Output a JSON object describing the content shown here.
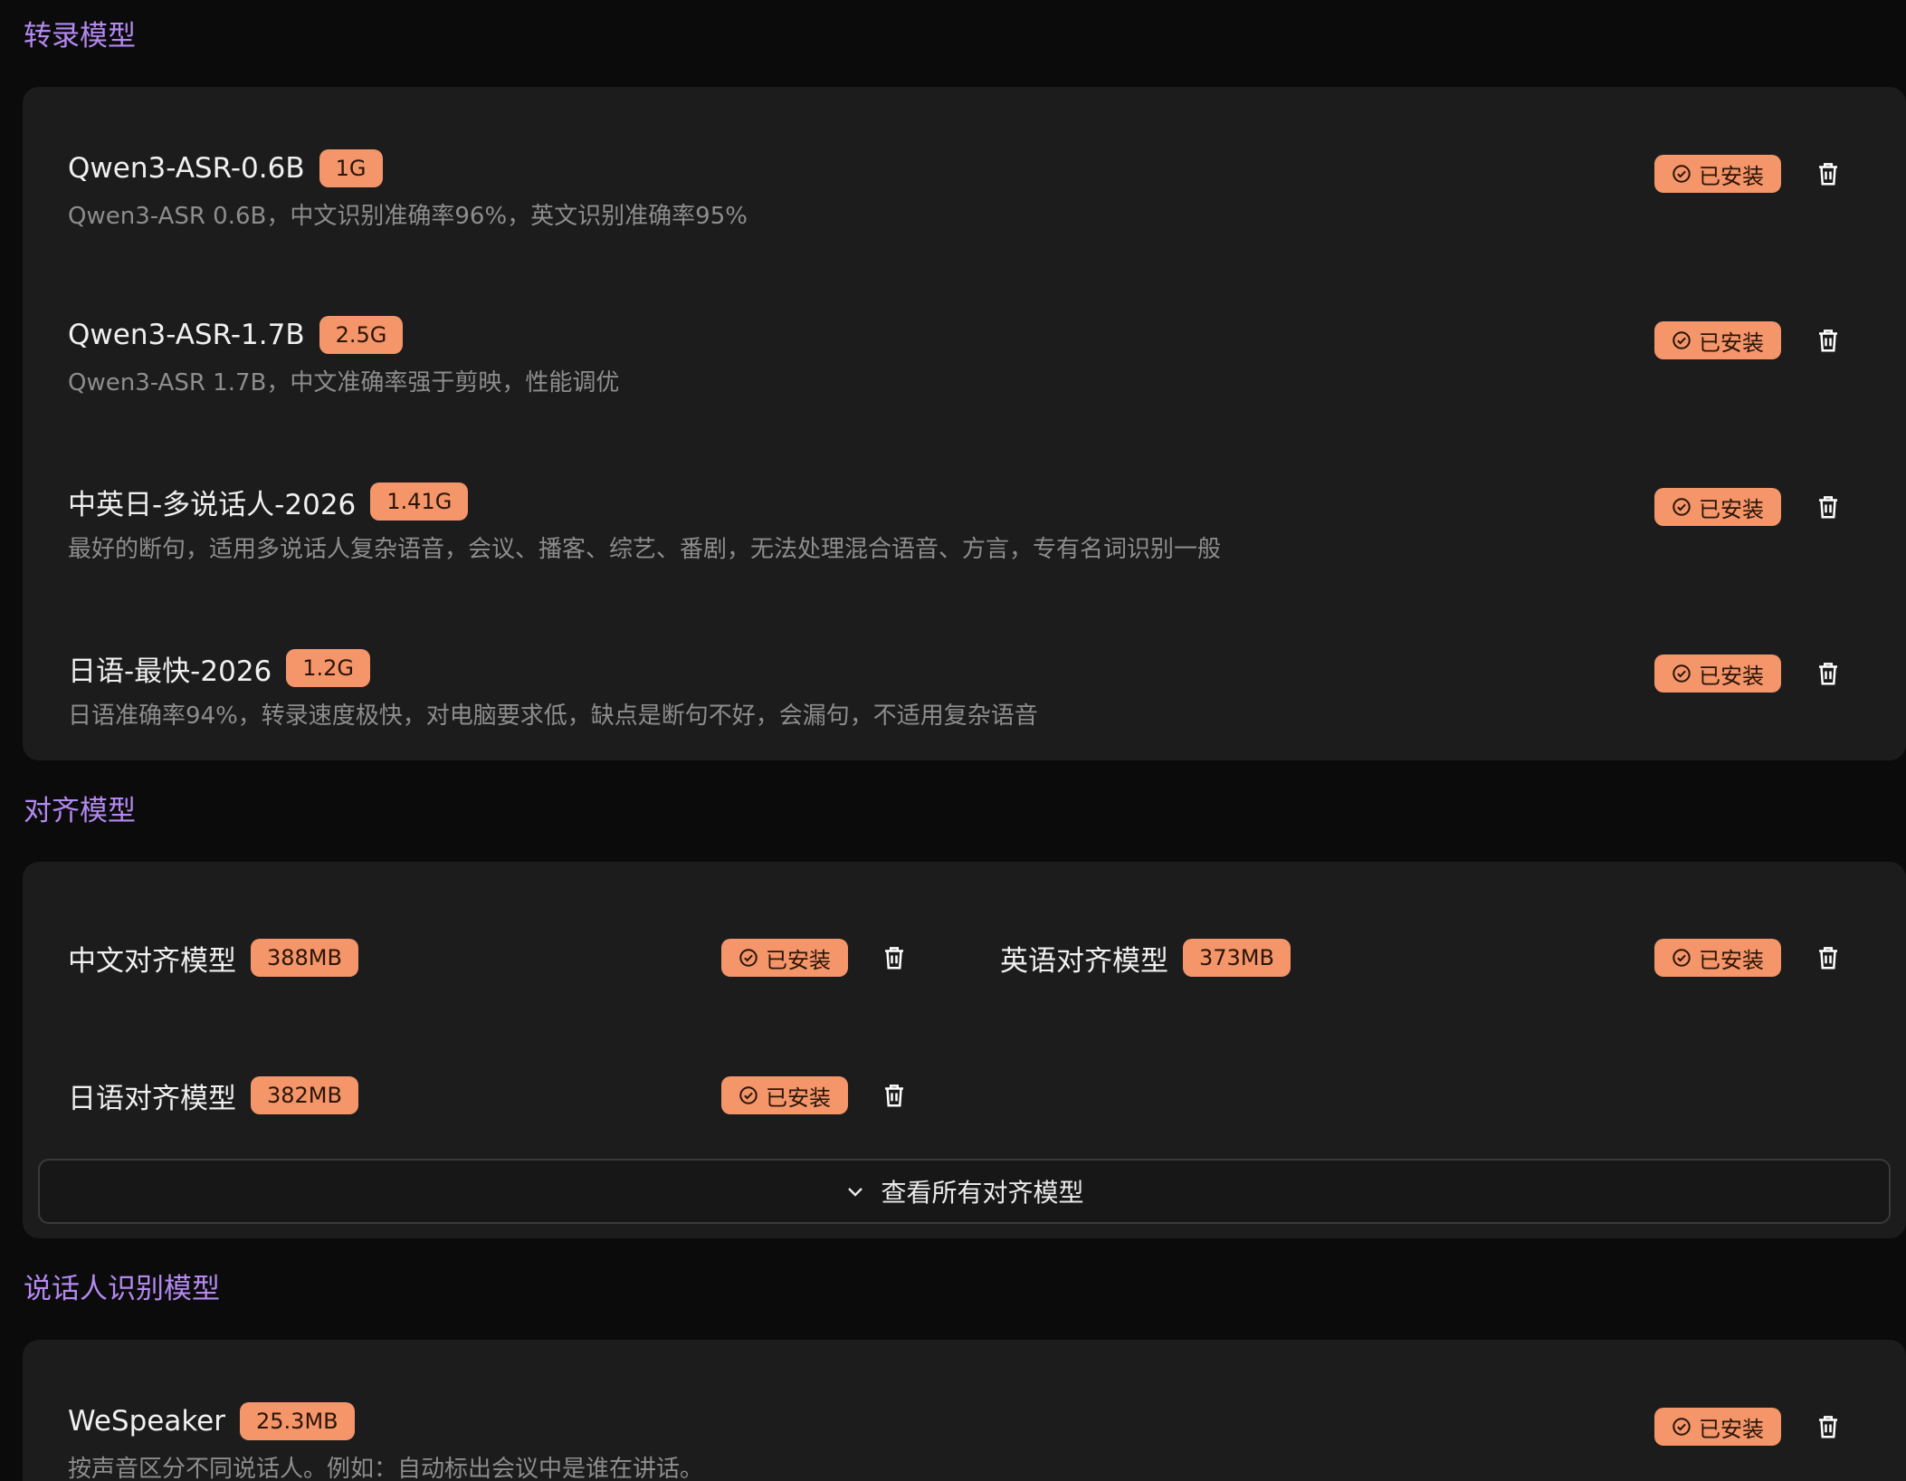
{
  "sections": {
    "transcription": {
      "title": "转录模型",
      "models": [
        {
          "name": "Qwen3-ASR-0.6B",
          "size": "1G",
          "desc": "Qwen3-ASR 0.6B，中文识别准确率96%，英文识别准确率95%",
          "status": "已安装"
        },
        {
          "name": "Qwen3-ASR-1.7B",
          "size": "2.5G",
          "desc": "Qwen3-ASR 1.7B，中文准确率强于剪映，性能调优",
          "status": "已安装"
        },
        {
          "name": "中英日-多说话人-2026",
          "size": "1.41G",
          "desc": "最好的断句，适用多说话人复杂语音，会议、播客、综艺、番剧，无法处理混合语音、方言，专有名词识别一般",
          "status": "已安装"
        },
        {
          "name": "日语-最快-2026",
          "size": "1.2G",
          "desc": "日语准确率94%，转录速度极快，对电脑要求低，缺点是断句不好，会漏句，不适用复杂语音",
          "status": "已安装"
        }
      ]
    },
    "alignment": {
      "title": "对齐模型",
      "models": [
        {
          "name": "中文对齐模型",
          "size": "388MB",
          "status": "已安装"
        },
        {
          "name": "英语对齐模型",
          "size": "373MB",
          "status": "已安装"
        },
        {
          "name": "日语对齐模型",
          "size": "382MB",
          "status": "已安装"
        }
      ],
      "expand_label": "查看所有对齐模型"
    },
    "speaker": {
      "title": "说话人识别模型",
      "models": [
        {
          "name": "WeSpeaker",
          "size": "25.3MB",
          "desc": "按声音区分不同说话人。例如：自动标出会议中是谁在讲话。",
          "status": "已安装"
        }
      ]
    }
  },
  "colors": {
    "accent": "#b389f0",
    "badge": "#f4956a",
    "card": "#1c1c1c",
    "background": "#0b0b0b"
  },
  "icons": {
    "installed": "check-circle-icon",
    "delete": "trash-icon",
    "expand": "chevron-down-icon"
  }
}
